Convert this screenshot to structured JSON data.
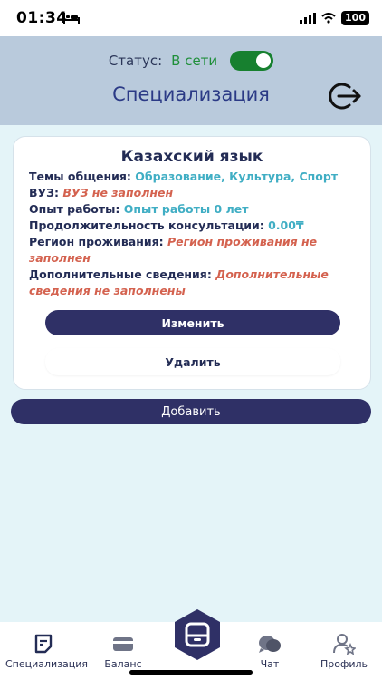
{
  "statusbar": {
    "time": "01:34",
    "battery": "100"
  },
  "header": {
    "status_label": "Статус:",
    "status_value": "В сети",
    "status_on": true,
    "title": "Специализация",
    "logout_icon": "logout-icon"
  },
  "card": {
    "title": "Казахский язык",
    "fields": [
      {
        "label": "Темы общения: ",
        "value": "Образование, Культура, Спорт",
        "state": "ok"
      },
      {
        "label": "ВУЗ: ",
        "value": "ВУЗ не заполнен",
        "state": "missing"
      },
      {
        "label": "Опыт работы: ",
        "value": "Опыт работы 0 лет",
        "state": "ok"
      },
      {
        "label": "Продолжительность консультации: ",
        "value": "0.00₸",
        "state": "ok"
      },
      {
        "label": "Регион проживания: ",
        "value": "Регион проживания не заполнен",
        "state": "missing"
      },
      {
        "label": "Дополнительные сведения: ",
        "value": "Дополнительные сведения не заполнены",
        "state": "missing"
      }
    ],
    "edit_label": "Изменить",
    "delete_label": "Удалить"
  },
  "add_label": "Добавить",
  "tabs": [
    {
      "label": "Специализация",
      "icon": "note-icon",
      "active": true
    },
    {
      "label": "Баланс",
      "icon": "card-icon"
    },
    {
      "label": "",
      "icon": "inbox-icon",
      "center": true
    },
    {
      "label": "Чат",
      "icon": "chat-icon"
    },
    {
      "label": "Профиль",
      "icon": "user-star-icon"
    }
  ],
  "colors": {
    "accent": "#2f3066",
    "header_bg": "#b9cadc",
    "page_bg": "#e4f4f8",
    "ok_value": "#40aec4",
    "missing_value": "#d4624f",
    "online": "#1f8f3a"
  }
}
